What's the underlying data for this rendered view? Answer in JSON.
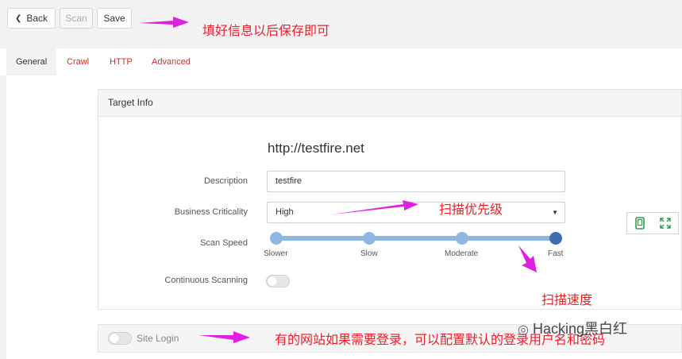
{
  "toolbar": {
    "back_label": "Back",
    "scan_label": "Scan",
    "save_label": "Save"
  },
  "tabs": [
    {
      "label": "General"
    },
    {
      "label": "Crawl"
    },
    {
      "label": "HTTP"
    },
    {
      "label": "Advanced"
    }
  ],
  "target_info": {
    "title": "Target Info",
    "url": "http://testfire.net",
    "description_label": "Description",
    "description_value": "testfire",
    "criticality_label": "Business Criticality",
    "criticality_value": "High",
    "scan_speed_label": "Scan Speed",
    "scan_speed_options": [
      "Slower",
      "Slow",
      "Moderate",
      "Fast"
    ],
    "scan_speed_selected": "Fast",
    "continuous_label": "Continuous Scanning"
  },
  "site_login": {
    "label": "Site Login"
  },
  "annotations": {
    "save_note": "填好信息以后保存即可",
    "priority_note": "扫描优先级",
    "speed_note": "扫描速度",
    "login_note": "有的网站如果需要登录，可以配置默认的登录用户名和密码"
  },
  "watermark": {
    "text": "Hacking黑白红"
  },
  "colors": {
    "annotation": "#e8202a",
    "arrow": "#e020e0",
    "slider_selected": "#3c6fb0",
    "slider": "#8fb6e0"
  }
}
